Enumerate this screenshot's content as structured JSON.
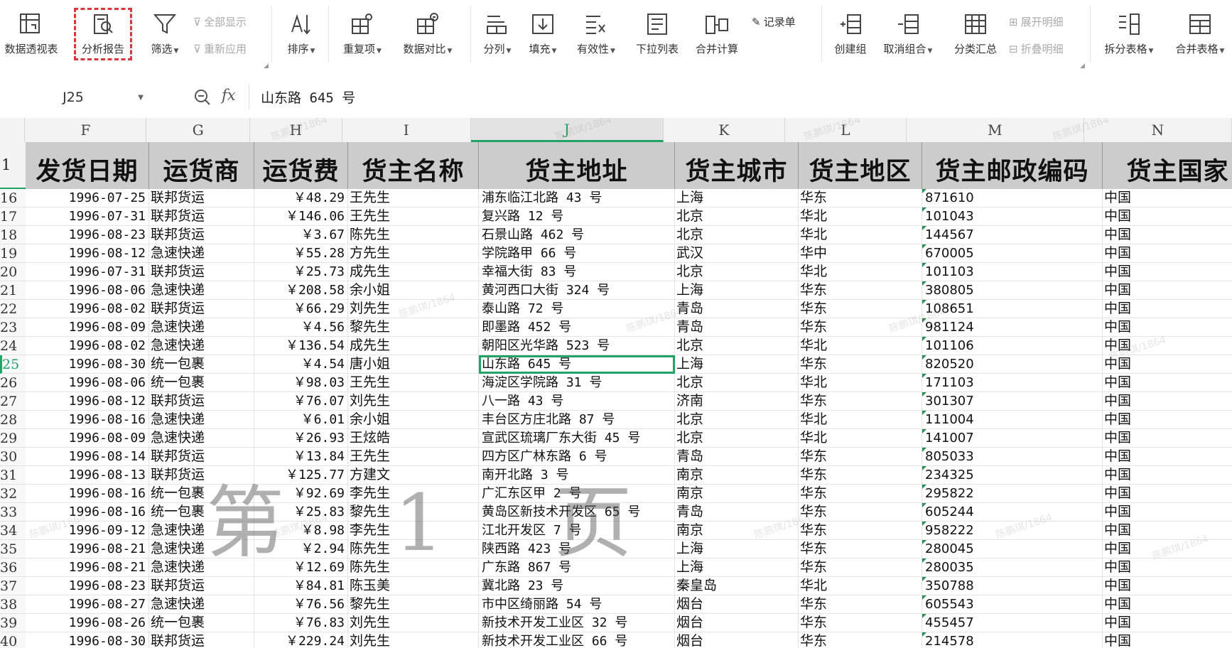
{
  "ribbon": {
    "pivot_table": "数据透视表",
    "analysis_report": "分析报告",
    "filter": "筛选",
    "show_all": "全部显示",
    "reapply": "重新应用",
    "sort": "排序",
    "duplicates": "重复项",
    "data_compare": "数据对比",
    "split_column": "分列",
    "fill": "填充",
    "validity": "有效性",
    "dropdown_list": "下拉列表",
    "merge_calc": "合并计算",
    "record_sheet": "记录单",
    "create_group": "创建组",
    "ungroup": "取消组合",
    "subtotal": "分类汇总",
    "expand_detail": "展开明细",
    "collapse_detail": "折叠明细",
    "split_table": "拆分表格",
    "merge_table": "合并表格"
  },
  "formula_bar": {
    "cell_ref": "J25",
    "fx_label": "fx",
    "content": "山东路 645 号"
  },
  "columns": [
    "F",
    "G",
    "H",
    "I",
    "J",
    "K",
    "L",
    "M",
    "N"
  ],
  "selected_column": "J",
  "header_row_number": "1",
  "headers": [
    "发货日期",
    "运货商",
    "运货费",
    "货主名称",
    "货主地址",
    "货主城市",
    "货主地区",
    "货主邮政编码",
    "货主国家"
  ],
  "rows": [
    {
      "n": "16",
      "date": "1996-07-25",
      "carrier": "联邦货运",
      "fee": "￥48.29",
      "name": "王先生",
      "addr": "浦东临江北路 43 号",
      "city": "上海",
      "region": "华东",
      "post": "871610",
      "country": "中国"
    },
    {
      "n": "17",
      "date": "1996-07-31",
      "carrier": "联邦货运",
      "fee": "￥146.06",
      "name": "王先生",
      "addr": "复兴路 12 号",
      "city": "北京",
      "region": "华北",
      "post": "101043",
      "country": "中国"
    },
    {
      "n": "18",
      "date": "1996-08-23",
      "carrier": "联邦货运",
      "fee": "￥3.67",
      "name": "陈先生",
      "addr": "石景山路 462 号",
      "city": "北京",
      "region": "华北",
      "post": "144567",
      "country": "中国"
    },
    {
      "n": "19",
      "date": "1996-08-12",
      "carrier": "急速快递",
      "fee": "￥55.28",
      "name": "方先生",
      "addr": "学院路甲 66 号",
      "city": "武汉",
      "region": "华中",
      "post": "670005",
      "country": "中国"
    },
    {
      "n": "20",
      "date": "1996-07-31",
      "carrier": "联邦货运",
      "fee": "￥25.73",
      "name": "成先生",
      "addr": "幸福大街 83 号",
      "city": "北京",
      "region": "华北",
      "post": "101103",
      "country": "中国"
    },
    {
      "n": "21",
      "date": "1996-08-06",
      "carrier": "急速快递",
      "fee": "￥208.58",
      "name": "余小姐",
      "addr": "黄河西口大街 324 号",
      "city": "上海",
      "region": "华东",
      "post": "380805",
      "country": "中国"
    },
    {
      "n": "22",
      "date": "1996-08-02",
      "carrier": "联邦货运",
      "fee": "￥66.29",
      "name": "刘先生",
      "addr": "泰山路 72 号",
      "city": "青岛",
      "region": "华东",
      "post": "108651",
      "country": "中国"
    },
    {
      "n": "23",
      "date": "1996-08-09",
      "carrier": "急速快递",
      "fee": "￥4.56",
      "name": "黎先生",
      "addr": "即墨路 452 号",
      "city": "青岛",
      "region": "华东",
      "post": "981124",
      "country": "中国"
    },
    {
      "n": "24",
      "date": "1996-08-02",
      "carrier": "急速快递",
      "fee": "￥136.54",
      "name": "成先生",
      "addr": "朝阳区光华路 523 号",
      "city": "北京",
      "region": "华北",
      "post": "101106",
      "country": "中国"
    },
    {
      "n": "25",
      "date": "1996-08-30",
      "carrier": "统一包裹",
      "fee": "￥4.54",
      "name": "唐小姐",
      "addr": "山东路 645 号",
      "city": "上海",
      "region": "华东",
      "post": "820520",
      "country": "中国",
      "active": true
    },
    {
      "n": "26",
      "date": "1996-08-06",
      "carrier": "统一包裹",
      "fee": "￥98.03",
      "name": "王先生",
      "addr": "海淀区学院路 31 号",
      "city": "北京",
      "region": "华北",
      "post": "171103",
      "country": "中国"
    },
    {
      "n": "27",
      "date": "1996-08-12",
      "carrier": "联邦货运",
      "fee": "￥76.07",
      "name": "刘先生",
      "addr": "八一路 43 号",
      "city": "济南",
      "region": "华东",
      "post": "301307",
      "country": "中国"
    },
    {
      "n": "28",
      "date": "1996-08-16",
      "carrier": "急速快递",
      "fee": "￥6.01",
      "name": "余小姐",
      "addr": "丰台区方庄北路 87 号",
      "city": "北京",
      "region": "华北",
      "post": "111004",
      "country": "中国"
    },
    {
      "n": "29",
      "date": "1996-08-09",
      "carrier": "急速快递",
      "fee": "￥26.93",
      "name": "王炫皓",
      "addr": "宣武区琉璃厂东大街 45 号",
      "city": "北京",
      "region": "华北",
      "post": "141007",
      "country": "中国"
    },
    {
      "n": "30",
      "date": "1996-08-14",
      "carrier": "联邦货运",
      "fee": "￥13.84",
      "name": "王先生",
      "addr": "四方区广林东路 6 号",
      "city": "青岛",
      "region": "华东",
      "post": "805033",
      "country": "中国"
    },
    {
      "n": "31",
      "date": "1996-08-13",
      "carrier": "联邦货运",
      "fee": "￥125.77",
      "name": "方建文",
      "addr": "南开北路 3 号",
      "city": "南京",
      "region": "华东",
      "post": "234325",
      "country": "中国"
    },
    {
      "n": "32",
      "date": "1996-08-16",
      "carrier": "统一包裹",
      "fee": "￥92.69",
      "name": "李先生",
      "addr": "广汇东区甲 2 号",
      "city": "南京",
      "region": "华东",
      "post": "295822",
      "country": "中国"
    },
    {
      "n": "33",
      "date": "1996-08-16",
      "carrier": "统一包裹",
      "fee": "￥25.83",
      "name": "黎先生",
      "addr": "黄岛区新技术开发区 65 号",
      "city": "青岛",
      "region": "华东",
      "post": "605244",
      "country": "中国"
    },
    {
      "n": "34",
      "date": "1996-09-12",
      "carrier": "急速快递",
      "fee": "￥8.98",
      "name": "李先生",
      "addr": "江北开发区 7 号",
      "city": "南京",
      "region": "华东",
      "post": "958222",
      "country": "中国"
    },
    {
      "n": "35",
      "date": "1996-08-21",
      "carrier": "急速快递",
      "fee": "￥2.94",
      "name": "陈先生",
      "addr": "陕西路 423 号",
      "city": "上海",
      "region": "华东",
      "post": "280045",
      "country": "中国"
    },
    {
      "n": "36",
      "date": "1996-08-21",
      "carrier": "急速快递",
      "fee": "￥12.69",
      "name": "陈先生",
      "addr": "广东路 867 号",
      "city": "上海",
      "region": "华东",
      "post": "280035",
      "country": "中国"
    },
    {
      "n": "37",
      "date": "1996-08-23",
      "carrier": "联邦货运",
      "fee": "￥84.81",
      "name": "陈玉美",
      "addr": "冀北路 23 号",
      "city": "秦皇岛",
      "region": "华北",
      "post": "350788",
      "country": "中国"
    },
    {
      "n": "38",
      "date": "1996-08-27",
      "carrier": "急速快递",
      "fee": "￥76.56",
      "name": "黎先生",
      "addr": "市中区绮丽路 54 号",
      "city": "烟台",
      "region": "华东",
      "post": "605543",
      "country": "中国"
    },
    {
      "n": "39",
      "date": "1996-08-26",
      "carrier": "统一包裹",
      "fee": "￥76.83",
      "name": "刘先生",
      "addr": "新技术开发工业区 32 号",
      "city": "烟台",
      "region": "华东",
      "post": "455457",
      "country": "中国"
    },
    {
      "n": "40",
      "date": "1996-08-30",
      "carrier": "联邦货运",
      "fee": "￥229.24",
      "name": "刘先生",
      "addr": "新技术开发工业区 66 号",
      "city": "烟台",
      "region": "华东",
      "post": "214578",
      "country": "中国"
    }
  ],
  "watermark_page": "第 1 页",
  "faint_watermark": "陈鹏琪/1864"
}
